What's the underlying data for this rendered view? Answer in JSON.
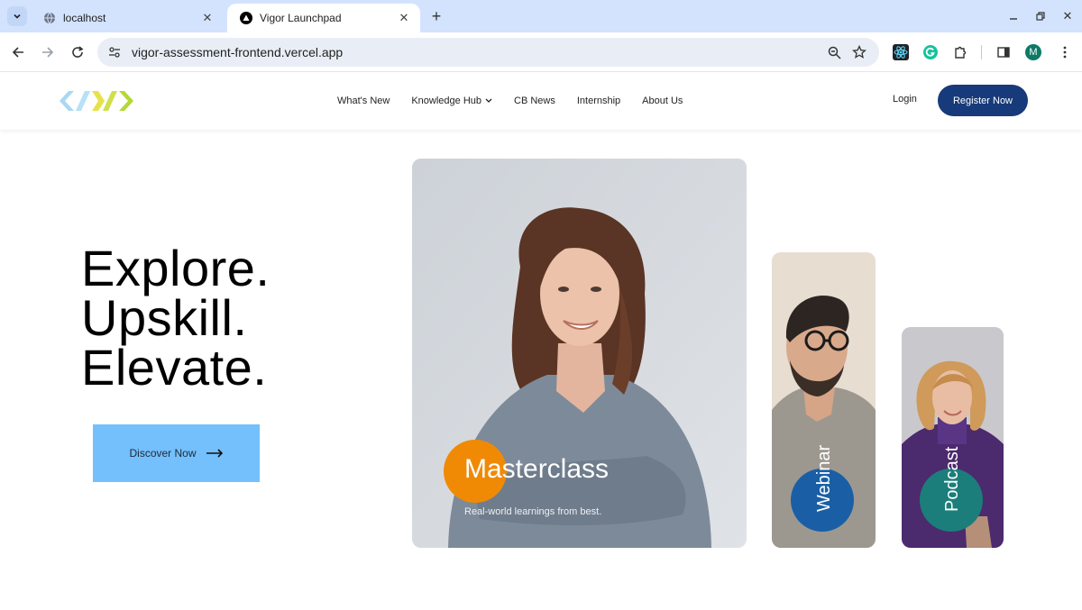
{
  "browser": {
    "tabs": [
      {
        "title": "localhost",
        "active": false
      },
      {
        "title": "Vigor Launchpad",
        "active": true
      }
    ],
    "url": "vigor-assessment-frontend.vercel.app",
    "profile_initial": "M"
  },
  "header": {
    "nav": [
      {
        "label": "What's New"
      },
      {
        "label": "Knowledge Hub",
        "has_dropdown": true
      },
      {
        "label": "CB News"
      },
      {
        "label": "Internship"
      },
      {
        "label": "About Us"
      }
    ],
    "login_label": "Login",
    "register_label": "Register Now"
  },
  "hero": {
    "lines": [
      "Explore.",
      "Upskill.",
      "Elevate."
    ],
    "cta_label": "Discover Now"
  },
  "cards": {
    "masterclass": {
      "title": "Masterclass",
      "subtitle": "Real-world learnings from best."
    },
    "webinar": {
      "title": "Webinar"
    },
    "podcast": {
      "title": "Podcast"
    }
  },
  "colors": {
    "register_bg": "#173a7a",
    "cta_bg": "#74c0fc",
    "masterclass_accent": "#f08a05",
    "webinar_accent": "#1a5fa6",
    "podcast_accent": "#1b7e7a"
  }
}
